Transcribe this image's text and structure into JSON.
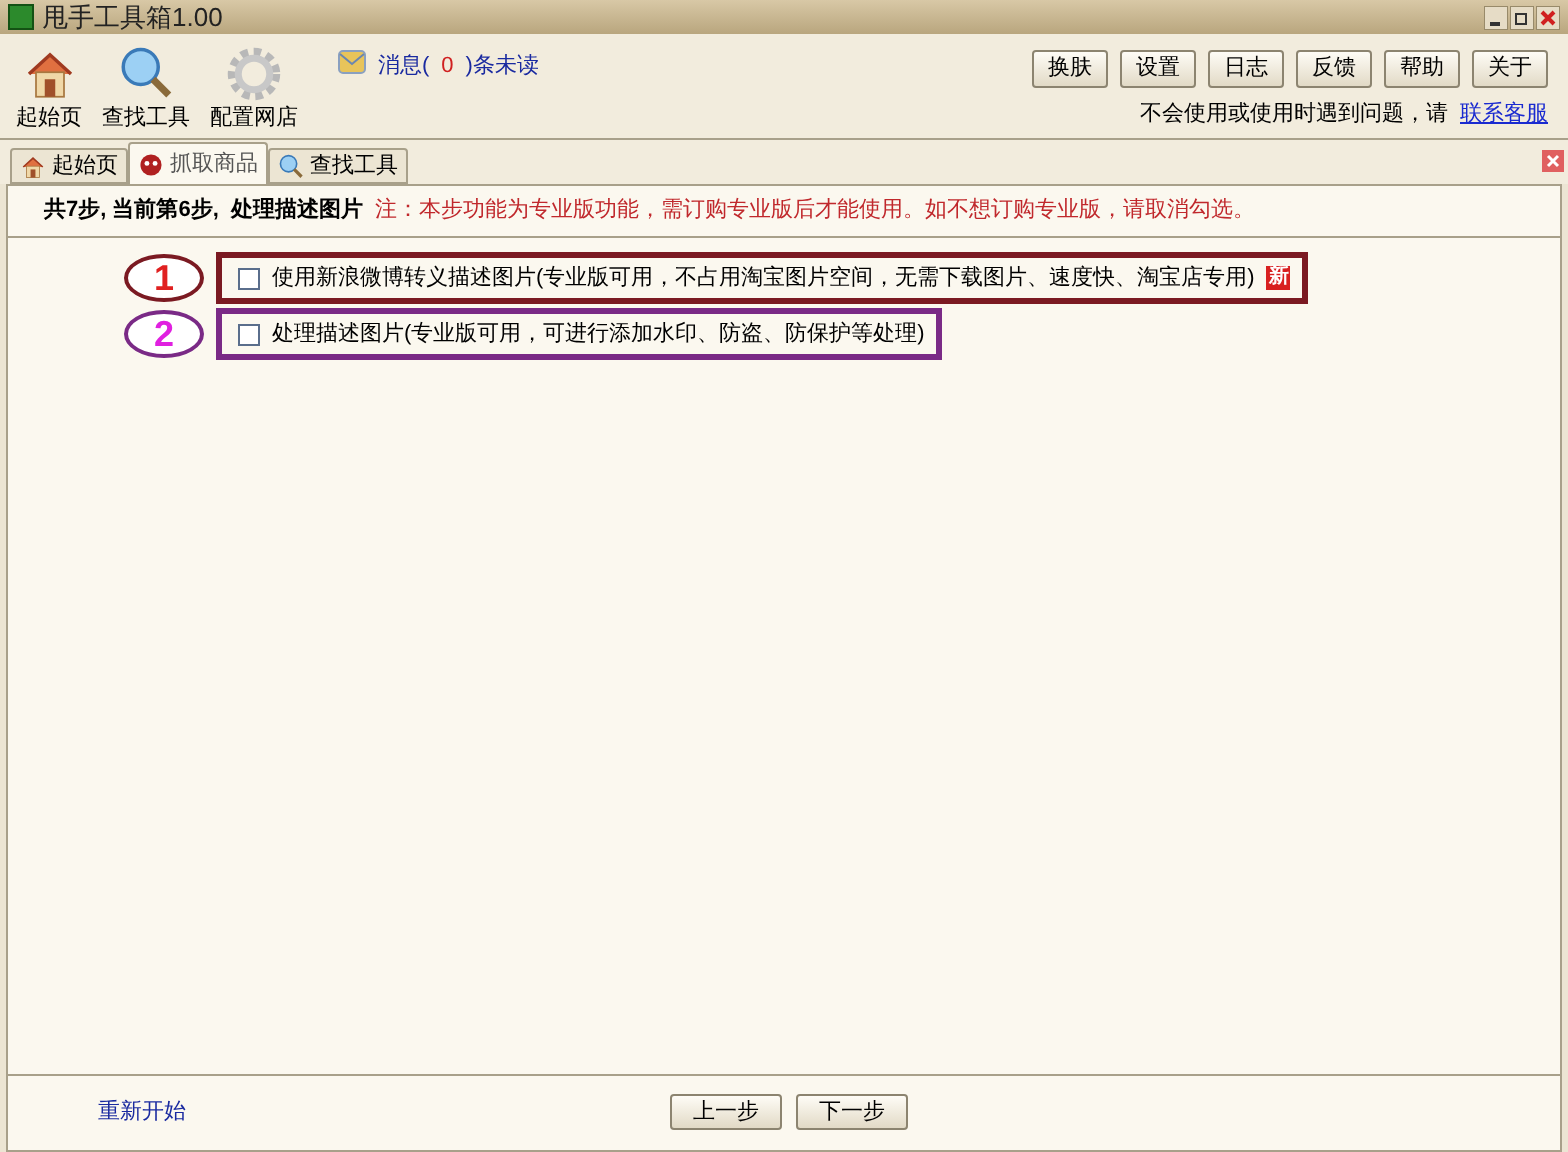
{
  "window": {
    "title": "甩手工具箱1.00"
  },
  "toolbar": {
    "items": [
      {
        "kind": "home",
        "label": "起始页"
      },
      {
        "kind": "search",
        "label": "查找工具"
      },
      {
        "kind": "gear",
        "label": "配置网店"
      }
    ],
    "messages": {
      "prefix": "消息(",
      "count": "0",
      "suffix": ")条未读"
    },
    "buttons": [
      "换肤",
      "设置",
      "日志",
      "反馈",
      "帮助",
      "关于"
    ],
    "help": {
      "text": "不会使用或使用时遇到问题，请",
      "link": "联系客服"
    }
  },
  "tabs": [
    {
      "kind": "home",
      "label": "起始页",
      "selected": false
    },
    {
      "kind": "bug",
      "label": "抓取商品",
      "selected": true
    },
    {
      "kind": "search",
      "label": "查找工具",
      "selected": false
    }
  ],
  "heading": {
    "step": "共7步, 当前第6步,",
    "title": "处理描述图片",
    "note": "注：本步功能为专业版功能，需订购专业版后才能使用。如不想订购专业版，请取消勾选。"
  },
  "options": [
    {
      "label": "使用新浪微博转义描述图片(专业版可用，不占用淘宝图片空间，无需下载图片、速度快、淘宝店专用)",
      "checked": false,
      "badge": "新",
      "marker": "1",
      "color": "#7b1a22"
    },
    {
      "label": "处理描述图片(专业版可用，可进行添加水印、防盗、防保护等处理)",
      "checked": false,
      "marker": "2",
      "color": "#7a2a86"
    }
  ],
  "footer": {
    "restart": "重新开始",
    "buttons": [
      "上一步",
      "下一步"
    ]
  }
}
